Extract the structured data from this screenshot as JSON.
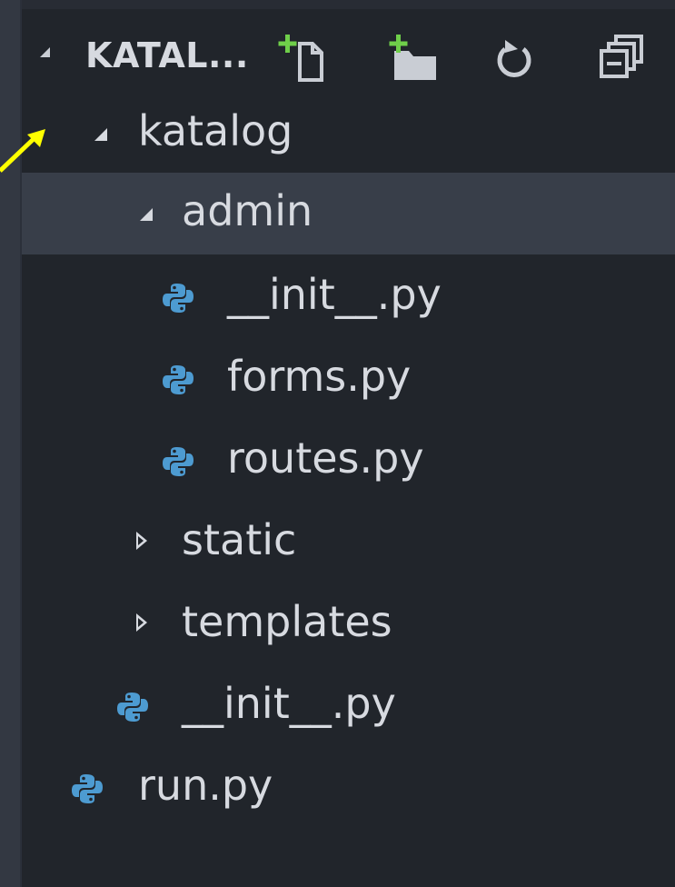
{
  "explorer": {
    "title": "KATAL...",
    "actions": [
      {
        "name": "new-file-icon"
      },
      {
        "name": "new-folder-icon"
      },
      {
        "name": "refresh-icon"
      },
      {
        "name": "collapse-all-icon"
      }
    ]
  },
  "tree": {
    "katalog": "katalog",
    "admin": "admin",
    "admin_init": "__init__.py",
    "forms": "forms.py",
    "routes": "routes.py",
    "static": "static",
    "templates": "templates",
    "katalog_init": "__init__.py",
    "run": "run.py"
  },
  "colors": {
    "background": "#21252b",
    "selected_row": "#383e49",
    "text": "#d7dae0",
    "python_icon": "#4d9bd1",
    "add_badge": "#6fcf4a",
    "annotation_arrow": "#ffff00"
  }
}
